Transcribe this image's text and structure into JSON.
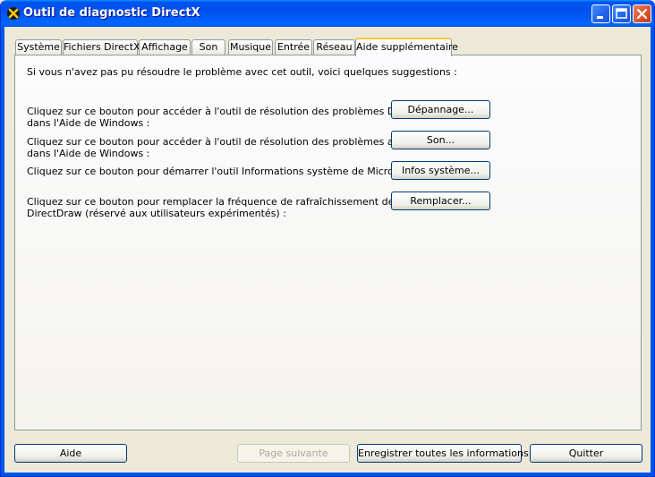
{
  "window": {
    "title": "Outil de diagnostic DirectX"
  },
  "tabs": [
    {
      "label": "Système"
    },
    {
      "label": "Fichiers DirectX"
    },
    {
      "label": "Affichage"
    },
    {
      "label": "Son"
    },
    {
      "label": "Musique"
    },
    {
      "label": "Entrée"
    },
    {
      "label": "Réseau"
    },
    {
      "label": "Aide supplémentaire",
      "active": true
    }
  ],
  "panel": {
    "intro": "Si vous n'avez pas pu résoudre le problème avec cet outil, voici quelques suggestions :",
    "rows": [
      {
        "line1": "Cliquez sur ce bouton pour accéder à l'outil de résolution des problèmes DirectX",
        "line2": "dans l'Aide de Windows :",
        "button": "Dépannage..."
      },
      {
        "line1": "Cliquez sur ce bouton pour accéder à l'outil de résolution des problèmes audio",
        "line2": "dans l'Aide de Windows :",
        "button": "Son..."
      },
      {
        "line1": "Cliquez sur ce bouton pour démarrer l'outil Informations système de Microsoft :",
        "line2": "",
        "button": "Infos système..."
      },
      {
        "line1": "Cliquez sur ce bouton pour remplacer la fréquence de rafraîchissement de",
        "line2": "DirectDraw (réservé aux utilisateurs expérimentés) :",
        "button": "Remplacer..."
      }
    ]
  },
  "footer": {
    "help": "Aide",
    "next_page": "Page suivante",
    "save_all": "Enregistrer toutes les informations...",
    "quit": "Quitter"
  },
  "colors": {
    "titlebar": "#0054e3",
    "face": "#ece9d8",
    "active_tab_accent": "#ffc83c",
    "close_button": "#d9532e"
  }
}
